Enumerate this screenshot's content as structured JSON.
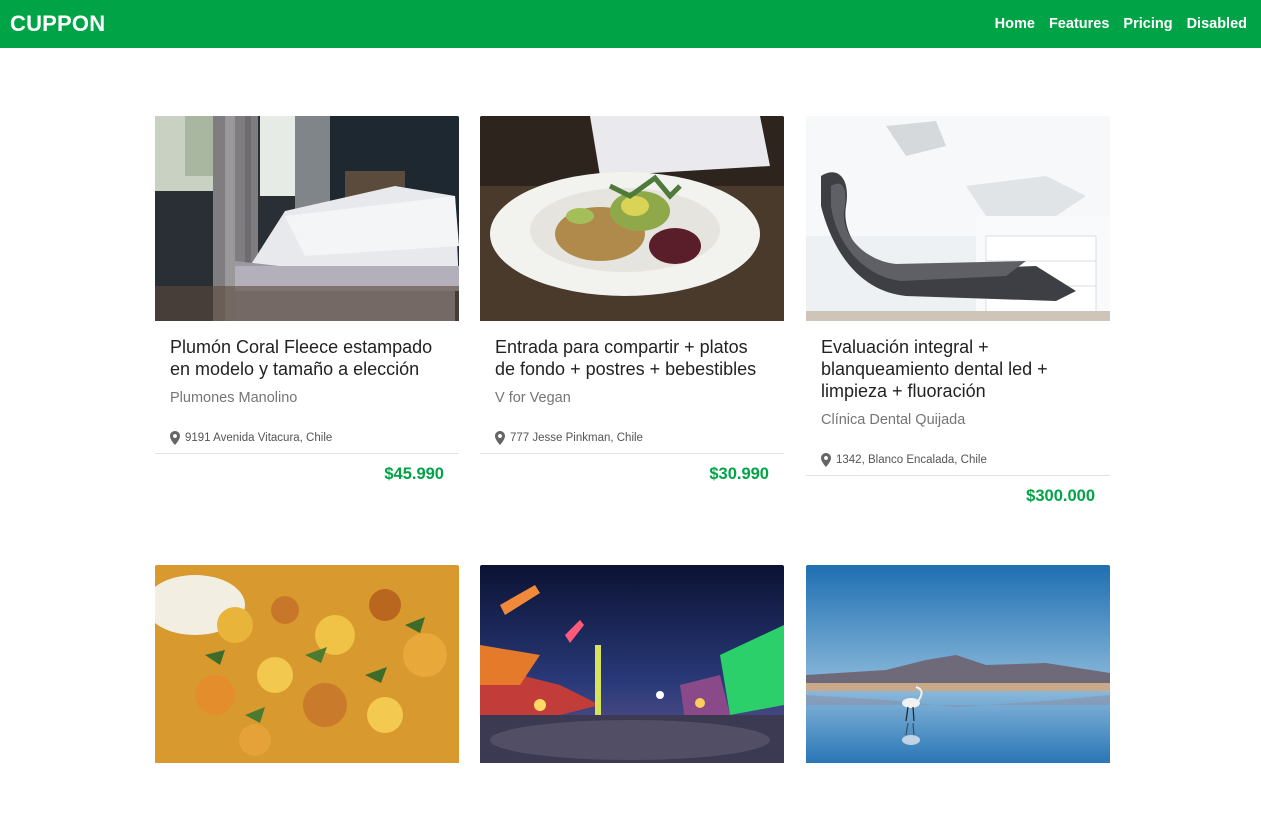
{
  "brand": "CUPPON",
  "nav": [
    "Home",
    "Features",
    "Pricing",
    "Disabled"
  ],
  "colors": {
    "accent": "#00a446",
    "text": "#222222",
    "muted": "#757575"
  },
  "cards": [
    {
      "title": "Plumón Coral Fleece estampado en modelo y tamaño a elección",
      "merchant": "Plumones Manolino",
      "location": "9191 Avenida Vitacura, Chile",
      "price": "$45.990",
      "image": "bedroom-photo"
    },
    {
      "title": "Entrada para compartir + platos de fondo + postres + bebestibles",
      "merchant": "V for Vegan",
      "location": "777 Jesse Pinkman, Chile",
      "price": "$30.990",
      "image": "vegan-salad-photo"
    },
    {
      "title": "Evaluación integral + blanqueamiento dental led + limpieza + fluoración",
      "merchant": "Clínica Dental Quijada",
      "location": "1342, Blanco Encalada, Chile",
      "price": "$300.000",
      "image": "dental-chair-photo"
    },
    {
      "image": "vegetable-stew-photo"
    },
    {
      "image": "night-fair-photo"
    },
    {
      "image": "flamingo-lake-photo"
    }
  ]
}
